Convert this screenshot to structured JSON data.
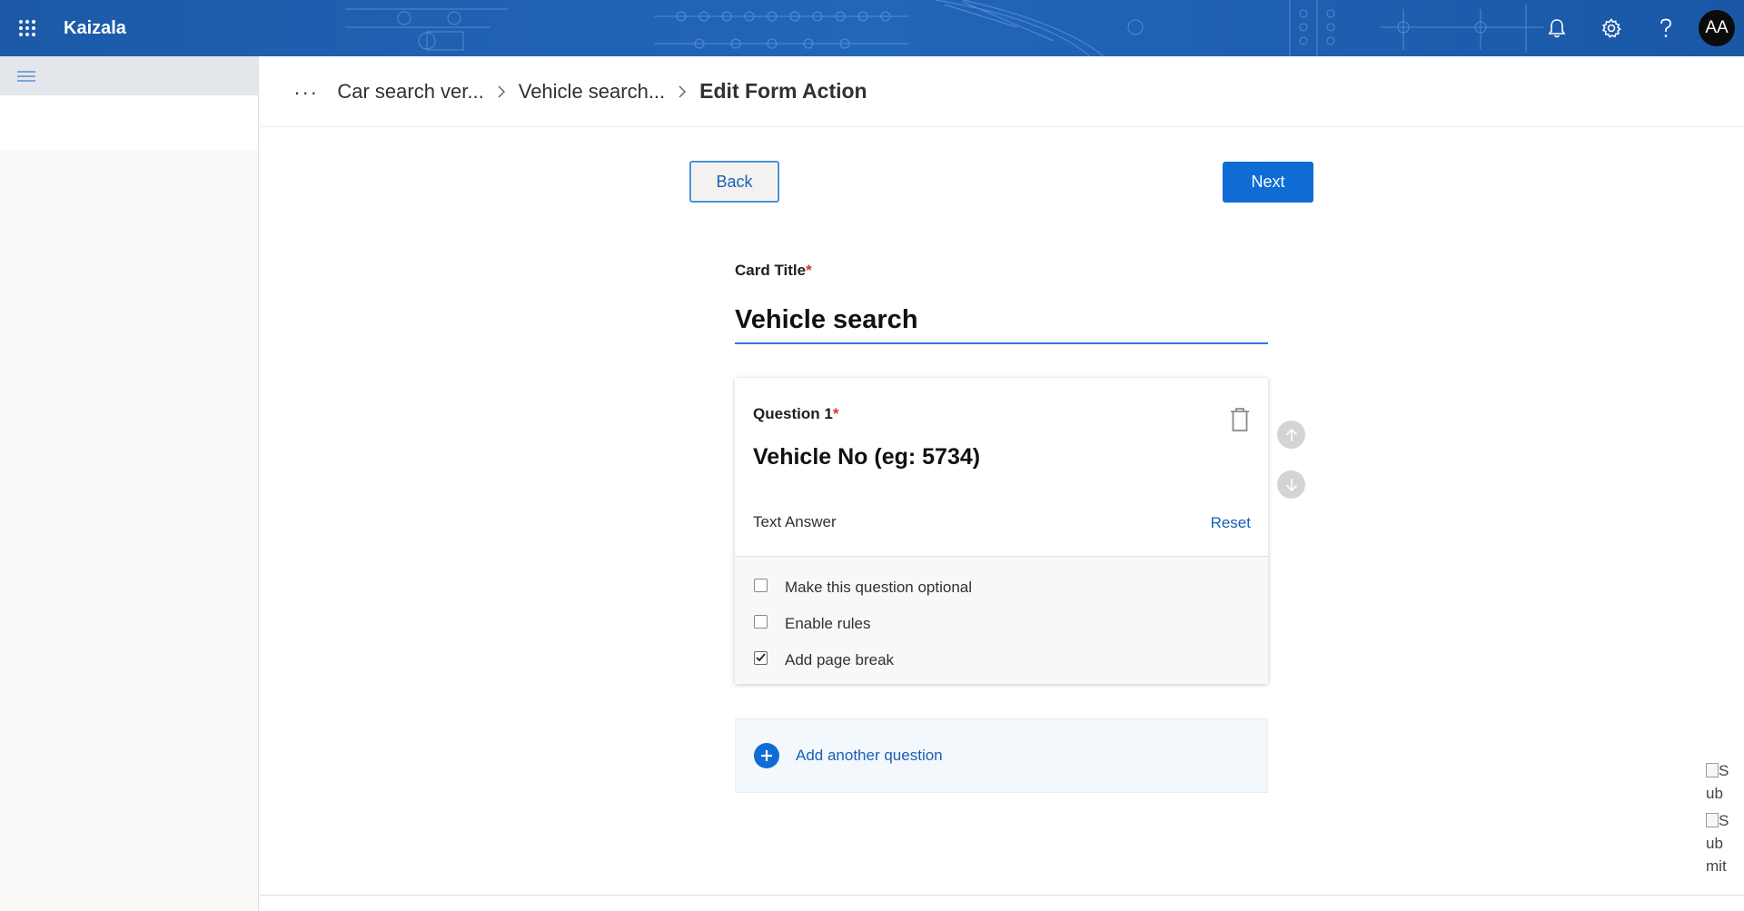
{
  "app": {
    "name": "Kaizala",
    "user_initials": "AA"
  },
  "topbar": {
    "icons": [
      "waffle-icon",
      "bell-icon",
      "gear-icon",
      "help-icon"
    ]
  },
  "breadcrumb": {
    "overflow": "...",
    "items": [
      "Car search ver...",
      "Vehicle search..."
    ],
    "current": "Edit Form Action"
  },
  "nav": {
    "back_label": "Back",
    "next_label": "Next"
  },
  "form": {
    "card_title_label": "Card Title",
    "required_mark": "*",
    "card_title_value": "Vehicle search"
  },
  "question": {
    "label": "Question 1",
    "required_mark": "*",
    "text": "Vehicle No (eg: 5734)",
    "answer_type": "Text Answer",
    "reset_label": "Reset",
    "options": [
      {
        "label": "Make this question optional",
        "checked": false
      },
      {
        "label": "Enable rules",
        "checked": false
      },
      {
        "label": "Add page break",
        "checked": true
      }
    ]
  },
  "add_question_label": "Add another question",
  "broken_images": [
    {
      "alt_line1": "S",
      "alt_line2": "ub"
    },
    {
      "alt_line1": "S",
      "alt_line2": "ub",
      "alt_line3": "mit"
    }
  ],
  "colors": {
    "accent": "#0f6cd5",
    "link": "#1a5fb4",
    "required": "#d13438",
    "topbar": "#1e5eb0"
  }
}
